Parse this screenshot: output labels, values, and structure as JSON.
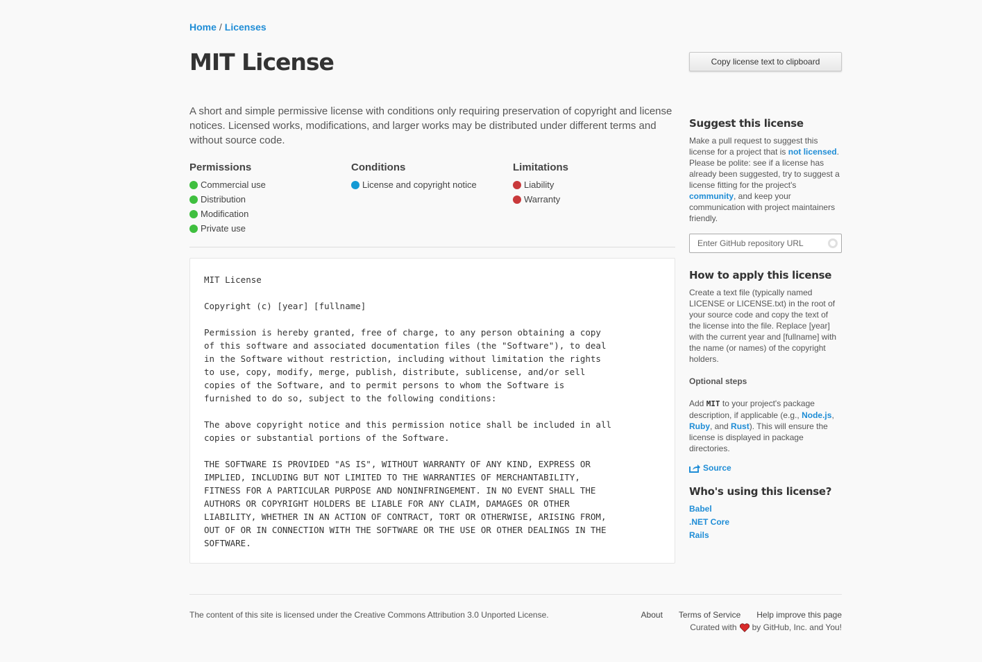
{
  "breadcrumb": {
    "home": "Home",
    "separator": "/",
    "licenses": "Licenses"
  },
  "title": "MIT License",
  "copy_button": "Copy license text to clipboard",
  "description": "A short and simple permissive license with conditions only requiring preservation of copyright and license notices. Licensed works, modifications, and larger works may be distributed under different terms and without source code.",
  "rules": {
    "permissions": {
      "heading": "Permissions",
      "color": "#3fbf3f",
      "items": [
        "Commercial use",
        "Distribution",
        "Modification",
        "Private use"
      ]
    },
    "conditions": {
      "heading": "Conditions",
      "color": "#149ad4",
      "items": [
        "License and copyright notice"
      ]
    },
    "limitations": {
      "heading": "Limitations",
      "color": "#c9393b",
      "items": [
        "Liability",
        "Warranty"
      ]
    }
  },
  "license_text": "MIT License\n\nCopyright (c) [year] [fullname]\n\nPermission is hereby granted, free of charge, to any person obtaining a copy\nof this software and associated documentation files (the \"Software\"), to deal\nin the Software without restriction, including without limitation the rights\nto use, copy, modify, merge, publish, distribute, sublicense, and/or sell\ncopies of the Software, and to permit persons to whom the Software is\nfurnished to do so, subject to the following conditions:\n\nThe above copyright notice and this permission notice shall be included in all\ncopies or substantial portions of the Software.\n\nTHE SOFTWARE IS PROVIDED \"AS IS\", WITHOUT WARRANTY OF ANY KIND, EXPRESS OR\nIMPLIED, INCLUDING BUT NOT LIMITED TO THE WARRANTIES OF MERCHANTABILITY,\nFITNESS FOR A PARTICULAR PURPOSE AND NONINFRINGEMENT. IN NO EVENT SHALL THE\nAUTHORS OR COPYRIGHT HOLDERS BE LIABLE FOR ANY CLAIM, DAMAGES OR OTHER\nLIABILITY, WHETHER IN AN ACTION OF CONTRACT, TORT OR OTHERWISE, ARISING FROM,\nOUT OF OR IN CONNECTION WITH THE SOFTWARE OR THE USE OR OTHER DEALINGS IN THE\nSOFTWARE.",
  "sidebar": {
    "suggest": {
      "heading": "Suggest this license",
      "text_1": "Make a pull request to suggest this license for a project that is ",
      "link_not_licensed": "not licensed",
      "text_2": ". Please be polite: see if a license has already been suggested, try to suggest a license fitting for the project's ",
      "link_community": "community",
      "text_3": ", and keep your communication with project maintainers friendly.",
      "input_placeholder": "Enter GitHub repository URL"
    },
    "apply": {
      "heading": "How to apply this license",
      "text": "Create a text file (typically named LICENSE or LICENSE.txt) in the root of your source code and copy the text of the license into the file. Replace [year] with the current year and [fullname] with the name (or names) of the copyright holders.",
      "optional_heading": "Optional steps",
      "opt_1": "Add ",
      "opt_code": "MIT",
      "opt_2": " to your project's package description, if applicable (e.g., ",
      "link_node": "Node.js",
      "opt_3": ", ",
      "link_ruby": "Ruby",
      "opt_4": ", and ",
      "link_rust": "Rust",
      "opt_5": "). This will ensure the license is displayed in package directories.",
      "source_link": "Source"
    },
    "users": {
      "heading": "Who's using this license?",
      "items": [
        "Babel",
        ".NET Core",
        "Rails"
      ]
    }
  },
  "footer": {
    "license_note": "The content of this site is licensed under the Creative Commons Attribution 3.0 Unported License.",
    "nav": [
      "About",
      "Terms of Service",
      "Help improve this page"
    ],
    "credit_1": "Curated with",
    "credit_2": "by GitHub, Inc. and You!"
  }
}
